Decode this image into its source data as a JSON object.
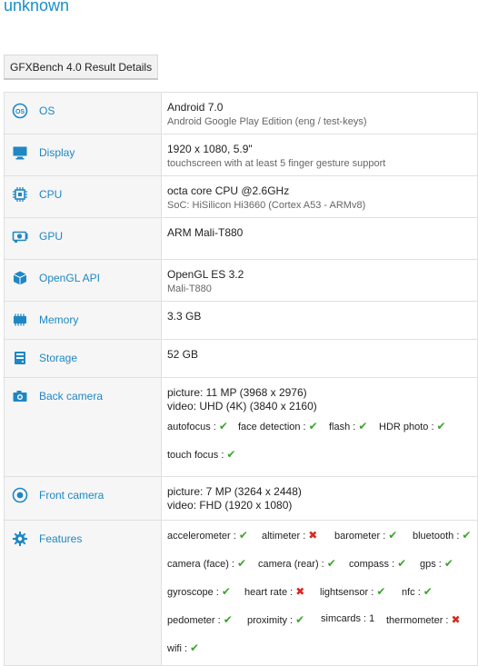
{
  "header": {
    "title": "unknown"
  },
  "tab": {
    "label": "GFXBench 4.0 Result Details"
  },
  "rows": {
    "os": {
      "label": "OS",
      "icon": "os-icon",
      "value": "Android 7.0",
      "sub": "Android Google Play Edition (eng / test-keys)"
    },
    "display": {
      "label": "Display",
      "icon": "monitor-icon",
      "value": "1920 x 1080, 5.9\"",
      "sub": "touchscreen with at least 5 finger gesture support"
    },
    "cpu": {
      "label": "CPU",
      "icon": "cpu-chip-icon",
      "value": "octa core CPU @2.6GHz",
      "sub": "SoC: HiSilicon Hi3660 (Cortex A53 - ARMv8)"
    },
    "gpu": {
      "label": "GPU",
      "icon": "gpu-icon",
      "value": "ARM Mali-T880"
    },
    "opengl": {
      "label": "OpenGL API",
      "icon": "cube-icon",
      "value": "OpenGL ES 3.2",
      "sub": "Mali-T880"
    },
    "memory": {
      "label": "Memory",
      "icon": "memory-icon",
      "value": "3.3 GB"
    },
    "storage": {
      "label": "Storage",
      "icon": "storage-icon",
      "value": "52 GB"
    },
    "back_camera": {
      "label": "Back camera",
      "icon": "camera-icon",
      "picture": "picture: 11 MP (3968 x 2976)",
      "video": "video: UHD (4K) (3840 x 2160)",
      "features": [
        {
          "name": "autofocus :",
          "ok": true
        },
        {
          "name": "face detection :",
          "ok": true
        },
        {
          "name": "flash :",
          "ok": true
        },
        {
          "name": "HDR photo :",
          "ok": true
        },
        {
          "name": "touch focus :",
          "ok": true
        }
      ]
    },
    "front_camera": {
      "label": "Front camera",
      "icon": "front-camera-icon",
      "picture": "picture: 7 MP (3264 x 2448)",
      "video": "video: FHD (1920 x 1080)"
    },
    "features": {
      "label": "Features",
      "icon": "gear-icon",
      "items": [
        {
          "name": "accelerometer :",
          "status": "yes"
        },
        {
          "name": "altimeter :",
          "status": "no"
        },
        {
          "name": "barometer :",
          "status": "yes"
        },
        {
          "name": "bluetooth :",
          "status": "yes"
        },
        {
          "name": "camera (face) :",
          "status": "yes"
        },
        {
          "name": "camera (rear) :",
          "status": "yes"
        },
        {
          "name": "compass :",
          "status": "yes"
        },
        {
          "name": "gps :",
          "status": "yes"
        },
        {
          "name": "gyroscope :",
          "status": "yes"
        },
        {
          "name": "heart rate :",
          "status": "no"
        },
        {
          "name": "lightsensor :",
          "status": "yes"
        },
        {
          "name": "nfc :",
          "status": "yes"
        },
        {
          "name": "pedometer :",
          "status": "yes"
        },
        {
          "name": "proximity :",
          "status": "yes"
        },
        {
          "name": "simcards : 1",
          "status": "text"
        },
        {
          "name": "thermometer :",
          "status": "no"
        },
        {
          "name": "wifi :",
          "status": "yes"
        }
      ]
    }
  },
  "colors": {
    "accent": "#1f87c3",
    "ok": "#3aa52a",
    "no": "#d9281e"
  }
}
